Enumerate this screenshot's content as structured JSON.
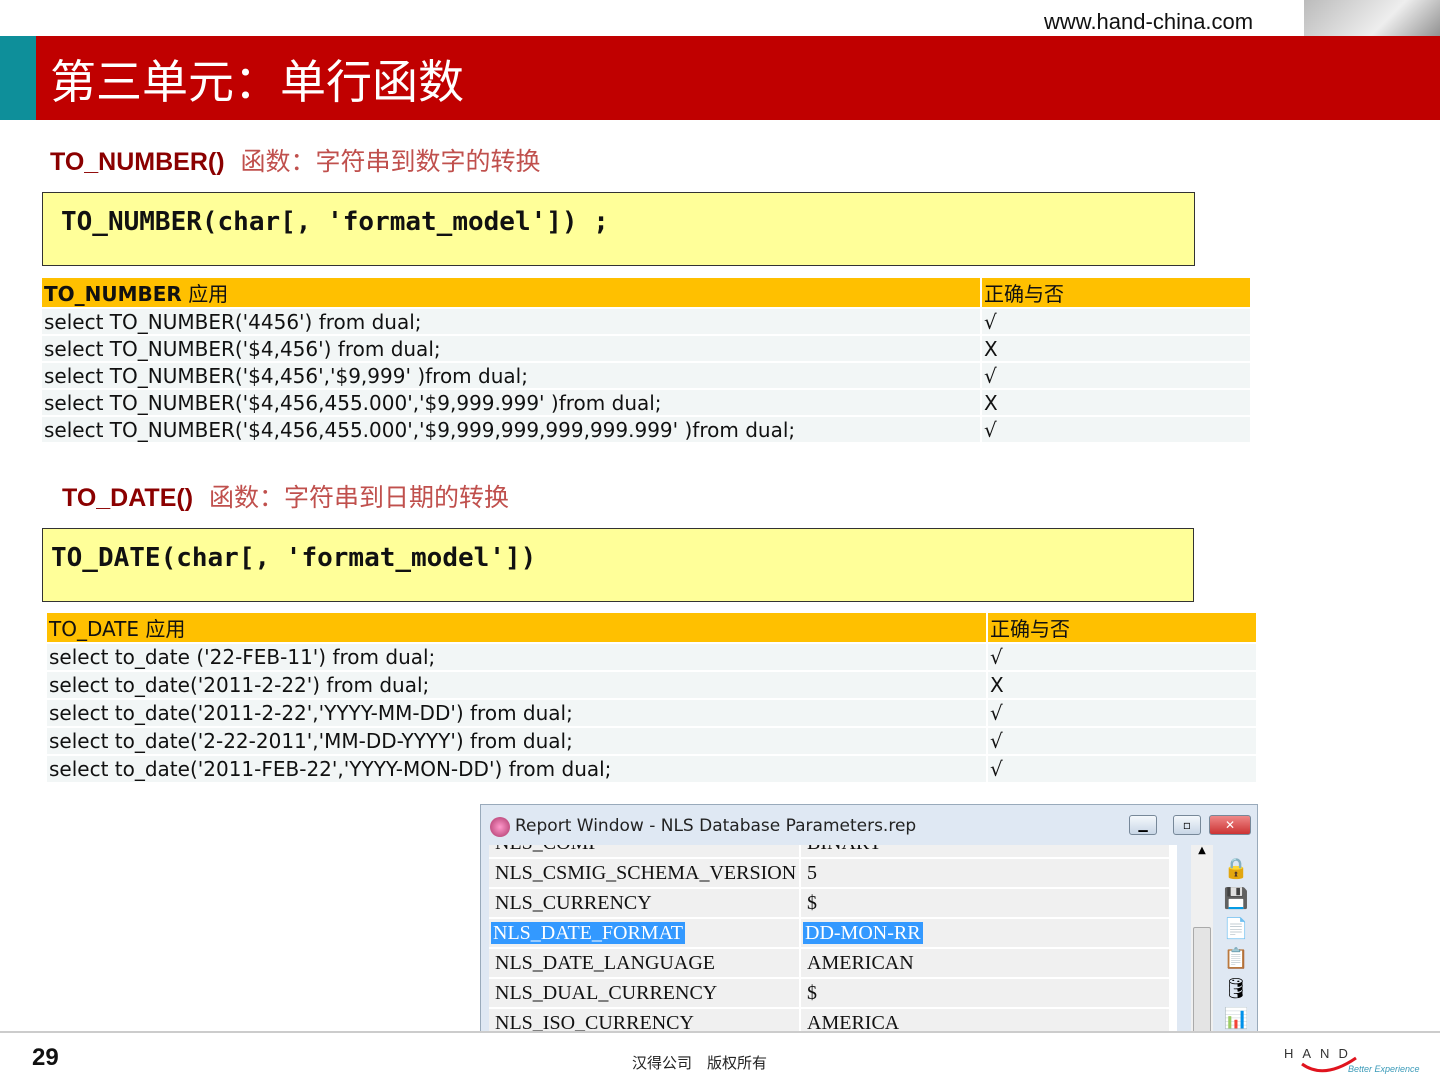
{
  "header": {
    "url": "www.hand-china.com",
    "title": "第三单元：单行函数"
  },
  "sec1": {
    "func": "TO_NUMBER()",
    "desc": "函数：字符串到数字的转换",
    "syntax": "TO_NUMBER(char[, 'format_model']) ;",
    "table": {
      "col1_bold": "TO_NUMBER",
      "col1_rest": " 应用",
      "col2": "正确与否",
      "rows": [
        [
          "select TO_NUMBER('4456') from dual;",
          "√"
        ],
        [
          "select TO_NUMBER('$4,456') from dual;",
          "X"
        ],
        [
          "select TO_NUMBER('$4,456','$9,999' )from dual;",
          "√"
        ],
        [
          "select TO_NUMBER('$4,456,455.000','$9,999.999' )from dual;",
          "X"
        ],
        [
          "select TO_NUMBER('$4,456,455.000','$9,999,999,999,999.999' )from dual;",
          "√"
        ]
      ]
    }
  },
  "sec2": {
    "func": "TO_DATE()",
    "desc": "函数：字符串到日期的转换",
    "syntax": "TO_DATE(char[, 'format_model'])",
    "table": {
      "col1": "TO_DATE 应用",
      "col2": "正确与否",
      "rows": [
        [
          "select to_date ('22-FEB-11') from dual;",
          "√"
        ],
        [
          "select to_date('2011-2-22') from dual;",
          "X"
        ],
        [
          "select to_date('2011-2-22','YYYY-MM-DD') from dual;",
          "√"
        ],
        [
          "select to_date('2-22-2011','MM-DD-YYYY') from dual;",
          "√"
        ],
        [
          "select to_date('2011-FEB-22','YYYY-MON-DD') from dual;",
          "√"
        ]
      ]
    }
  },
  "window": {
    "title": "Report Window - NLS Database Parameters.rep",
    "partial_row": [
      "NLS_COMP",
      "BINARY"
    ],
    "rows": [
      [
        "NLS_CSMIG_SCHEMA_VERSION",
        "5"
      ],
      [
        "NLS_CURRENCY",
        "$"
      ],
      [
        "NLS_DATE_FORMAT",
        "DD-MON-RR"
      ],
      [
        "NLS_DATE_LANGUAGE",
        "AMERICAN"
      ],
      [
        "NLS_DUAL_CURRENCY",
        "$"
      ],
      [
        "NLS_ISO_CURRENCY",
        "AMERICA"
      ]
    ],
    "selected_row": "NLS_DATE_FORMAT",
    "tools": [
      "lock-icon",
      "save-icon",
      "pdf-icon",
      "copy-icon",
      "database-export-icon",
      "chart-icon"
    ]
  },
  "footer": {
    "page": "29",
    "copyright": "汉得公司　版权所有",
    "logo_text": "HAND",
    "logo_tagline": "Better Experience"
  },
  "colors": {
    "red": "#c00000",
    "teal": "#0e8f9a",
    "table_header": "#ffc000",
    "code_box": "#ffff99",
    "selection": "#3399ff"
  }
}
